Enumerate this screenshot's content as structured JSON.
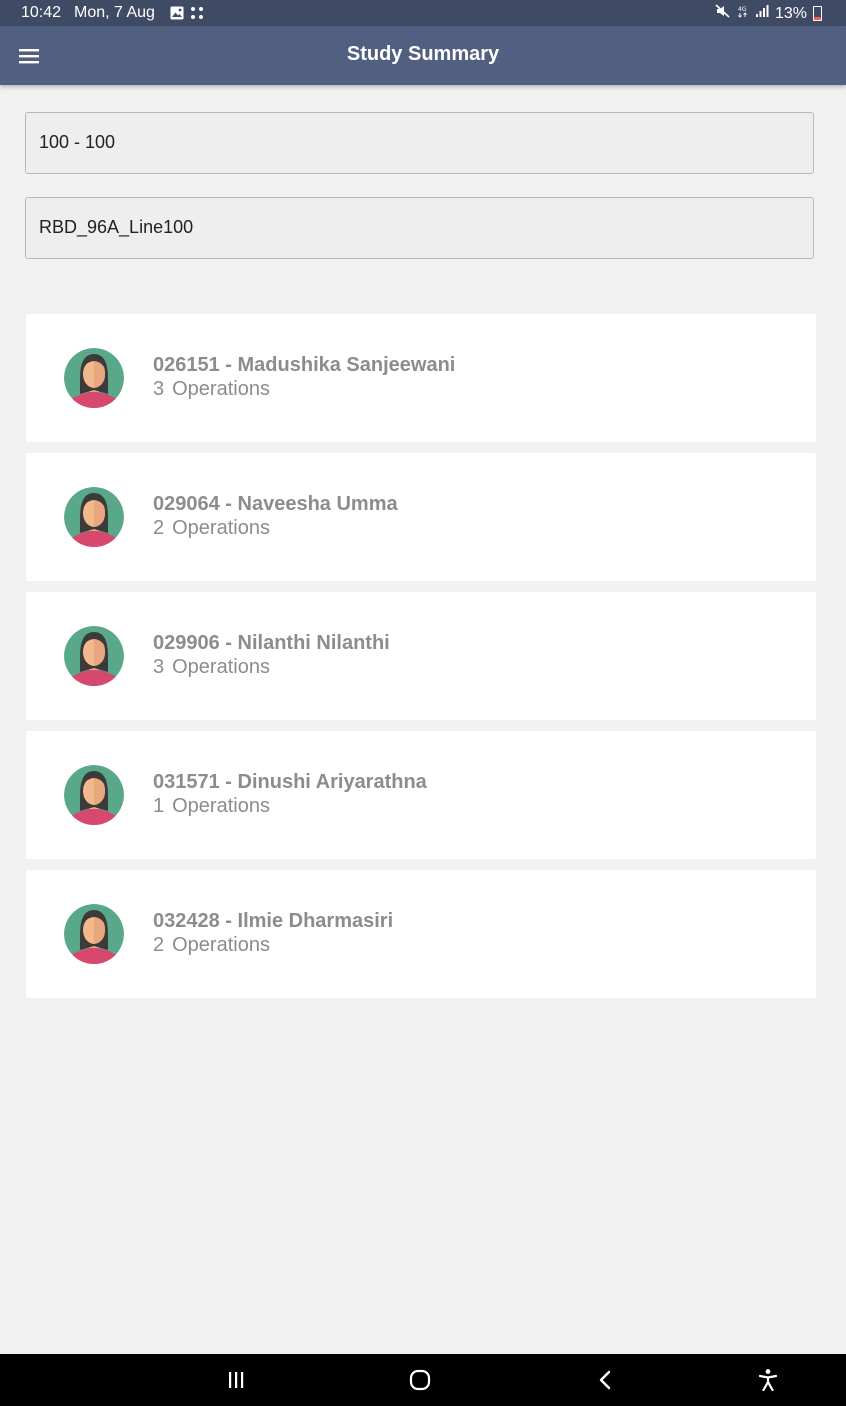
{
  "status_bar": {
    "time": "10:42",
    "date": "Mon, 7 Aug",
    "battery": "13%",
    "icons": [
      "gallery-icon",
      "apps-grid-icon",
      "mute-icon",
      "4g-icon",
      "signal-icon",
      "battery-icon"
    ]
  },
  "app_bar": {
    "title": "Study Summary",
    "menu_icon": "hamburger-menu-icon"
  },
  "fields": {
    "line_range": "100 - 100",
    "line_name": "RBD_96A_Line100"
  },
  "operators": [
    {
      "name": "026151 - Madushika Sanjeewani",
      "count": "3",
      "unit": "Operations"
    },
    {
      "name": "029064 - Naveesha Umma",
      "count": "2",
      "unit": "Operations"
    },
    {
      "name": "029906 - Nilanthi Nilanthi",
      "count": "3",
      "unit": "Operations"
    },
    {
      "name": "031571 - Dinushi Ariyarathna",
      "count": "1",
      "unit": "Operations"
    },
    {
      "name": "032428 - Ilmie Dharmasiri",
      "count": "2",
      "unit": "Operations"
    }
  ],
  "nav_bar": {
    "buttons": [
      "recent-apps-icon",
      "home-icon",
      "back-icon",
      "accessibility-icon"
    ]
  },
  "colors": {
    "status_bar": "#3f4a64",
    "app_bar": "#515f80",
    "background": "#f1f1f1",
    "card": "#ffffff",
    "text_muted": "#8c8c8c"
  }
}
